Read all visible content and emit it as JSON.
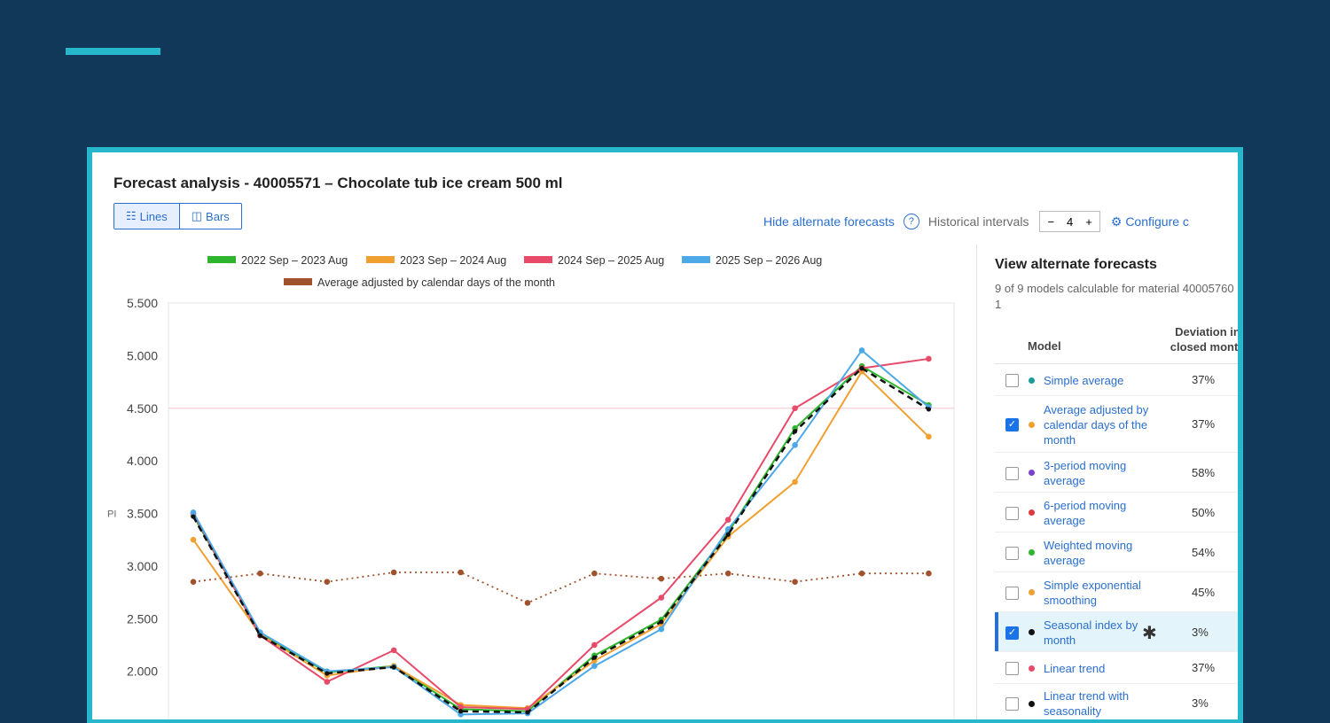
{
  "title": "Forecast analysis - 40005571 – Chocolate tub ice cream 500 ml",
  "view_toggle": {
    "lines": "Lines",
    "bars": "Bars",
    "active": "lines"
  },
  "toolbar": {
    "hide_alt": "Hide alternate forecasts",
    "help": "?",
    "hist_label": "Historical intervals",
    "minus": "−",
    "hist_value": "4",
    "plus": "+",
    "configure": "⚙ Configure c"
  },
  "chart_data": {
    "type": "line",
    "ylabel": "PI",
    "y_ticks": [
      "5.500",
      "5.000",
      "4.500",
      "4.000",
      "3.500",
      "3.000",
      "2.500",
      "2.000"
    ],
    "ylim": [
      1500,
      5500
    ],
    "x_count": 12,
    "reference_line": 4500,
    "series": [
      {
        "name": "2022 Sep – 2023 Aug",
        "color": "#2db52d",
        "values": [
          3480,
          2360,
          1990,
          2050,
          1640,
          1620,
          2150,
          2490,
          3320,
          4310,
          4900,
          4530
        ]
      },
      {
        "name": "2023 Sep – 2024 Aug",
        "color": "#f0a030",
        "values": [
          3250,
          2350,
          1960,
          2050,
          1680,
          1650,
          2100,
          2450,
          3280,
          3800,
          4850,
          4230
        ]
      },
      {
        "name": "2024 Sep – 2025 Aug",
        "color": "#e84a6a",
        "values": [
          3500,
          2340,
          1900,
          2200,
          1660,
          1640,
          2250,
          2700,
          3440,
          4500,
          4880,
          4970
        ]
      },
      {
        "name": "2025 Sep – 2026 Aug",
        "color": "#4da8e8",
        "values": [
          3510,
          2370,
          2000,
          2040,
          1590,
          1600,
          2050,
          2400,
          3350,
          4150,
          5050,
          4510
        ]
      },
      {
        "name": "Average adjusted by calendar days of the month",
        "color": "#a0522d",
        "dotted": true,
        "values": [
          2850,
          2930,
          2850,
          2940,
          2940,
          2650,
          2930,
          2880,
          2930,
          2850,
          2930,
          2930
        ]
      },
      {
        "name": "",
        "color": "#111111",
        "dashed": true,
        "values": [
          3470,
          2340,
          1980,
          2040,
          1620,
          1610,
          2130,
          2470,
          3300,
          4280,
          4880,
          4490
        ]
      }
    ]
  },
  "side": {
    "title": "View alternate forecasts",
    "subtitle": "9 of 9 models calculable for material 400057601",
    "col_model": "Model",
    "col_dev_1": "Deviation in",
    "col_dev_2": "closed month",
    "rows": [
      {
        "name": "Simple average",
        "dev": "37%",
        "color": "#1a9a9a",
        "checked": false
      },
      {
        "name": "Average adjusted by calendar days of the month",
        "dev": "37%",
        "color": "#f0a030",
        "checked": true
      },
      {
        "name": "3-period moving average",
        "dev": "58%",
        "color": "#7b3fd0",
        "checked": false
      },
      {
        "name": "6-period moving average",
        "dev": "50%",
        "color": "#e03a3a",
        "checked": false
      },
      {
        "name": "Weighted moving average",
        "dev": "54%",
        "color": "#2db52d",
        "checked": false
      },
      {
        "name": "Simple exponential smoothing",
        "dev": "45%",
        "color": "#f0a030",
        "checked": false
      },
      {
        "name": "Seasonal index by month",
        "dev": "3%",
        "color": "#111111",
        "checked": true,
        "selected": true,
        "star": "✱"
      },
      {
        "name": "Linear trend",
        "dev": "37%",
        "color": "#e84a6a",
        "checked": false
      },
      {
        "name": "Linear trend with seasonality",
        "dev": "3%",
        "color": "#111111",
        "checked": false
      }
    ]
  }
}
